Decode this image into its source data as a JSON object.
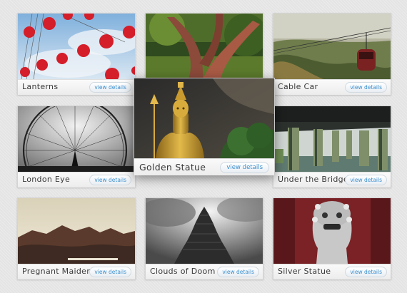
{
  "gallery": {
    "button_label": "view details",
    "items": [
      {
        "title": "Lanterns",
        "button": "view details",
        "photo": "red paper lanterns against blue sky"
      },
      {
        "title": "",
        "button": "",
        "photo": "twisted tree trunks"
      },
      {
        "title": "Cable Car",
        "button": "view details",
        "photo": "cable car over green hills"
      },
      {
        "title": "London Eye",
        "button": "view details",
        "photo": "ferris wheel against cloudy sky"
      },
      {
        "title": "Golden Statue",
        "button": "view details",
        "photo": "golden statue in front of rock cliff"
      },
      {
        "title": "Under the Bridge",
        "button": "view details",
        "photo": "pillars under a bridge over water"
      },
      {
        "title": "Pregnant Maiden",
        "button": "view details",
        "photo": "mountain range at dusk"
      },
      {
        "title": "Clouds of Doom",
        "button": "view details",
        "photo": "temple tower under dark clouds"
      },
      {
        "title": "Silver Statue",
        "button": "view details",
        "photo": "silver guardian lion statue"
      }
    ]
  }
}
